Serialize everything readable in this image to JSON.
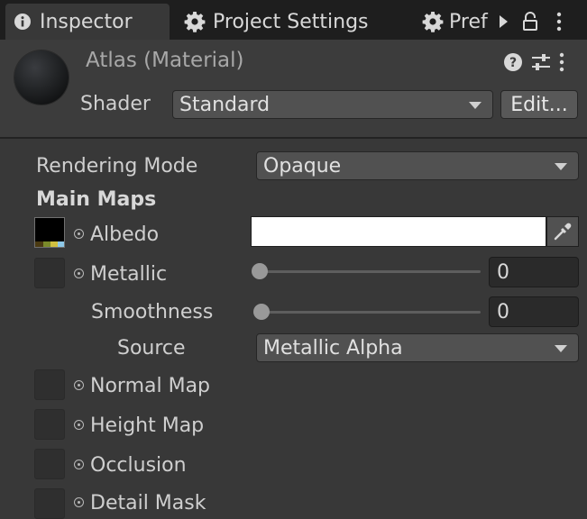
{
  "tabs": [
    {
      "label": "Inspector",
      "icon": "info-icon",
      "active": true
    },
    {
      "label": "Project Settings",
      "icon": "gear-icon",
      "active": false
    },
    {
      "label": "Pref",
      "icon": "gear-icon",
      "active": false
    }
  ],
  "header": {
    "title": "Atlas (Material)",
    "shader_label": "Shader",
    "shader_value": "Standard",
    "edit_label": "Edit..."
  },
  "fields": {
    "rendering_mode_label": "Rendering Mode",
    "rendering_mode_value": "Opaque",
    "main_maps_label": "Main Maps",
    "albedo_label": "Albedo",
    "albedo_color": "#ffffff",
    "metallic_label": "Metallic",
    "metallic_value": "0",
    "smoothness_label": "Smoothness",
    "smoothness_value": "0",
    "source_label": "Source",
    "source_value": "Metallic Alpha",
    "normal_map_label": "Normal Map",
    "height_map_label": "Height Map",
    "occlusion_label": "Occlusion",
    "detail_mask_label": "Detail Mask"
  },
  "colors": {
    "panel": "#383838",
    "tabbar": "#1e1e1e",
    "field": "#515151"
  }
}
